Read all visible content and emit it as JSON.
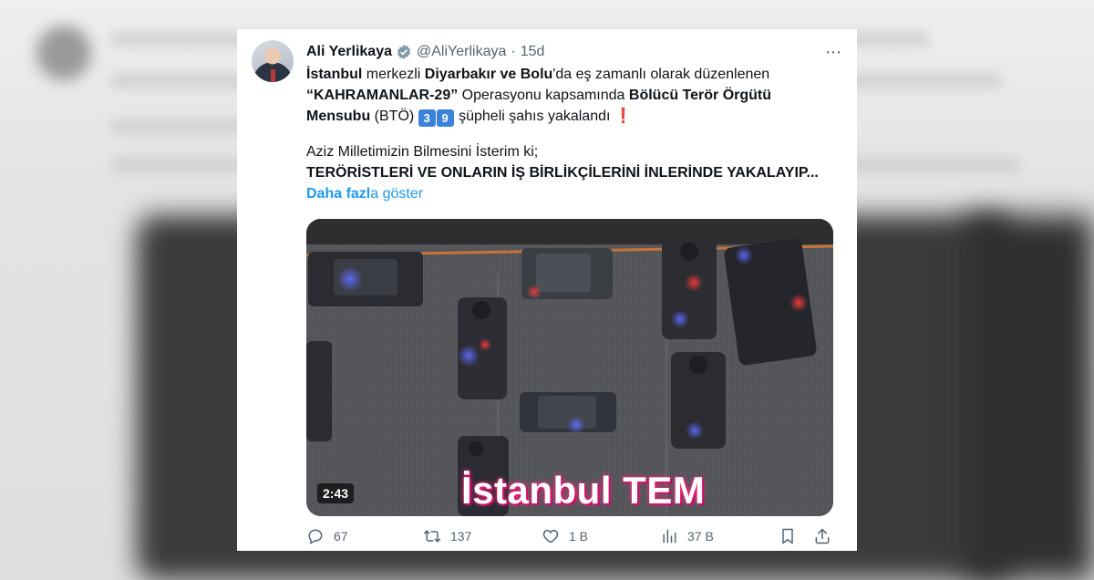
{
  "tweet": {
    "author_name": "Ali Yerlikaya",
    "handle": "@AliYerlikaya",
    "separator": "·",
    "time": "15d",
    "more_icon": "⋯",
    "line1": {
      "a": "İstanbul",
      "b": " merkezli ",
      "c": "Diyarbakır ve Bolu",
      "d": "'da eş zamanlı olarak düzenlenen"
    },
    "line2": {
      "a": "“KAHRAMANLAR-29”",
      "b": " Operasyonu kapsamında ",
      "c": "Bölücü Terör Örgütü"
    },
    "line3": {
      "a": "Mensubu",
      "b": " (BTÖ) ",
      "num1": "3",
      "num2": "9",
      "c": " şüpheli şahıs yakalandı ",
      "excl": "❗"
    },
    "line4": "Aziz Milletimizin Bilmesini İsterim ki;",
    "line5": "TERÖRİSTLERİ VE ONLARIN İŞ BİRLİKÇİLERİNİ İNLERİNDE YAKALAYIP...",
    "show_more": {
      "bold": "Daha fazl",
      "rest": "a göster"
    }
  },
  "video": {
    "duration": "2:43",
    "caption": "İstanbul TEM"
  },
  "actions": {
    "reply": {
      "icon": "reply-icon",
      "count": "67"
    },
    "retweet": {
      "icon": "retweet-icon",
      "count": "137"
    },
    "like": {
      "icon": "heart-icon",
      "count": "1 B"
    },
    "views": {
      "icon": "views-icon",
      "count": "37 B"
    },
    "bookmark": {
      "icon": "bookmark-icon"
    },
    "share": {
      "icon": "share-icon"
    }
  },
  "colors": {
    "accent": "#1d9bf0",
    "text": "#0f1419",
    "muted": "#536471",
    "emoji_blue": "#3b83d9",
    "excl_red": "#e0202b"
  }
}
